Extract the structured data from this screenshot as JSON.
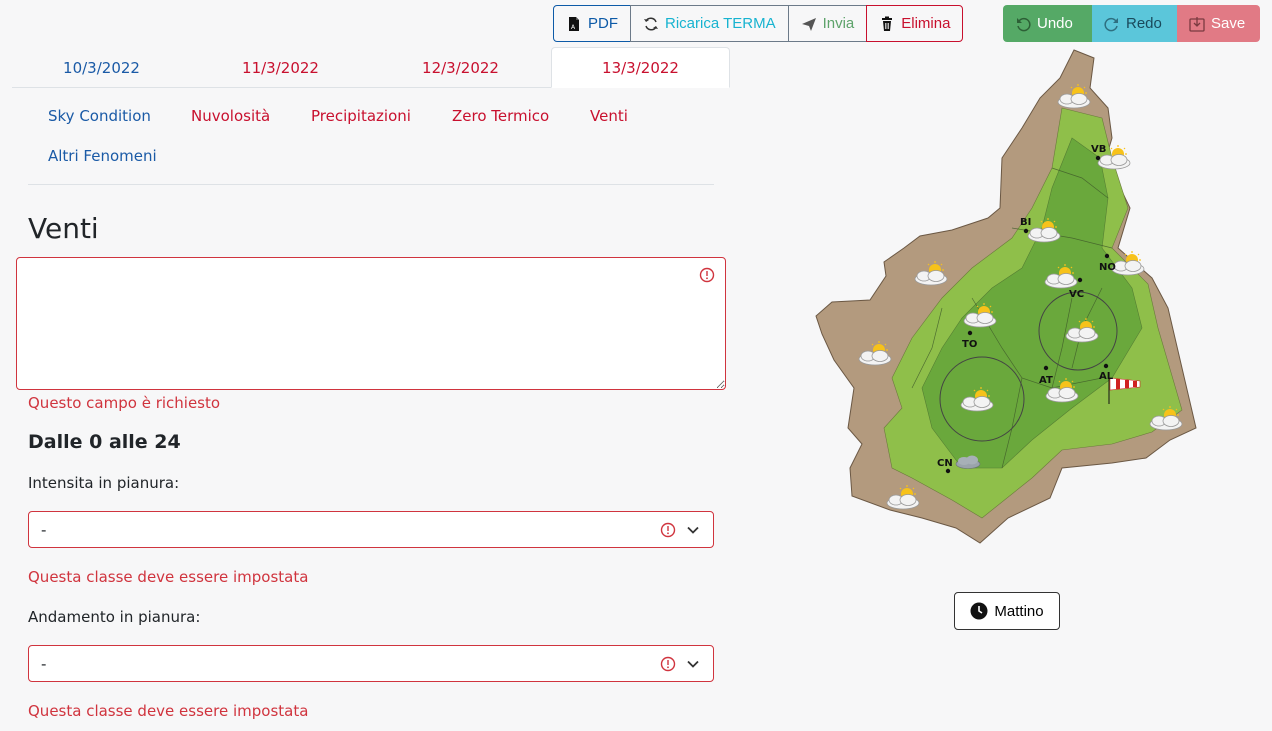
{
  "toolbar": {
    "pdf_label": "PDF",
    "ricarica_label": "Ricarica TERMA",
    "invia_label": "Invia",
    "elimina_label": "Elimina"
  },
  "history": {
    "undo_label": "Undo",
    "redo_label": "Redo",
    "save_label": "Save"
  },
  "date_tabs": [
    {
      "label": "10/3/2022",
      "color": "#1a5aa6"
    },
    {
      "label": "11/3/2022",
      "color": "#c8102e"
    },
    {
      "label": "12/3/2022",
      "color": "#c8102e"
    },
    {
      "label": "13/3/2022",
      "color": "#c8102e",
      "active": true
    }
  ],
  "sub_tabs": [
    {
      "label": "Sky Condition",
      "color": "#1a5aa6"
    },
    {
      "label": "Nuvolosità",
      "color": "#c8102e"
    },
    {
      "label": "Precipitazioni",
      "color": "#c8102e"
    },
    {
      "label": "Zero Termico",
      "color": "#c8102e"
    },
    {
      "label": "Venti",
      "color": "#c8102e",
      "active": true
    },
    {
      "label": "Altri Fenomeni",
      "color": "#1a5aa6"
    }
  ],
  "section": {
    "title": "Venti",
    "textarea_value": "",
    "textarea_error": "Questo campo è richiesto",
    "subheading": "Dalle 0 alle 24"
  },
  "fields": {
    "intensita": {
      "label": "Intensita in pianura:",
      "value": "-",
      "error": "Questa classe deve essere impostata"
    },
    "andamento": {
      "label": "Andamento in pianura:",
      "value": "-",
      "error": "Questa classe deve essere impostata"
    }
  },
  "map": {
    "cities": [
      "VB",
      "BI",
      "NO",
      "VC",
      "TO",
      "AT",
      "AL",
      "CN"
    ],
    "weather_icons": [
      "partly-cloudy-icon",
      "overcast-icon",
      "windsock-icon"
    ]
  },
  "time_button": {
    "label": "Mattino",
    "icon": "clock-icon"
  },
  "colors": {
    "error": "#d0343e",
    "link": "#1a5aa6",
    "undo": "#55a966",
    "redo": "#5bc6da",
    "save": "#e17a85"
  }
}
